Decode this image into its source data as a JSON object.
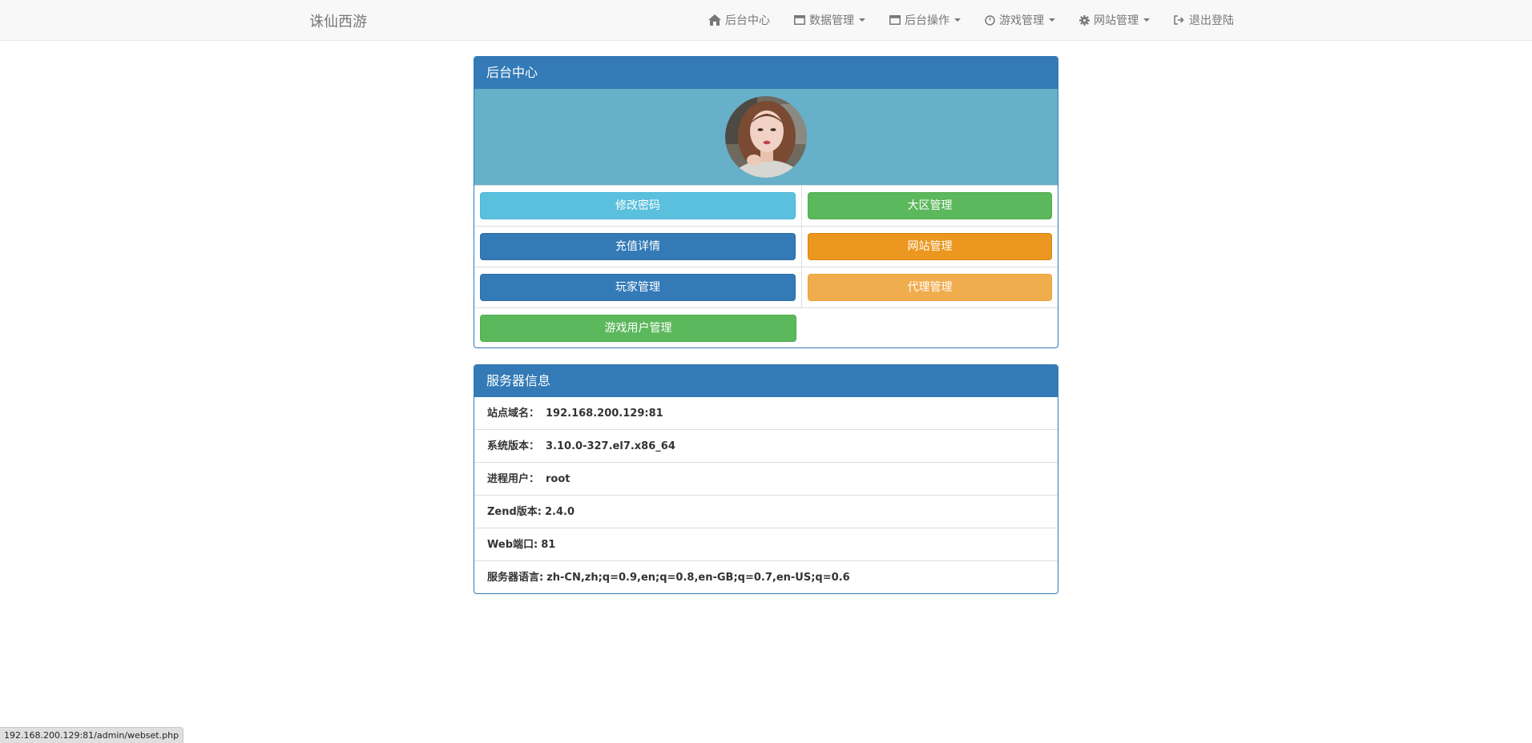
{
  "brand": "诛仙西游",
  "nav": {
    "items": [
      {
        "label": "后台中心",
        "icon": "home-icon",
        "dropdown": false
      },
      {
        "label": "数据管理",
        "icon": "window-icon",
        "dropdown": true
      },
      {
        "label": "后台操作",
        "icon": "window-icon",
        "dropdown": true
      },
      {
        "label": "游戏管理",
        "icon": "dashboard-icon",
        "dropdown": true
      },
      {
        "label": "网站管理",
        "icon": "gear-icon",
        "dropdown": true
      },
      {
        "label": "退出登陆",
        "icon": "logout-icon",
        "dropdown": false
      }
    ]
  },
  "admin_panel": {
    "title": "后台中心",
    "avatar": "user-avatar-photo",
    "buttons": {
      "change_password": "修改密码",
      "region_manage": "大区管理",
      "recharge_details": "充值详情",
      "site_manage": "网站管理",
      "player_manage": "玩家管理",
      "agent_manage": "代理管理",
      "game_user_manage": "游戏用户管理"
    }
  },
  "server_panel": {
    "title": "服务器信息",
    "rows": [
      {
        "label": "站点域名：",
        "value": "192.168.200.129:81"
      },
      {
        "label": "系统版本：",
        "value": "3.10.0-327.el7.x86_64"
      },
      {
        "label": "进程用户：",
        "value": "root"
      },
      {
        "label": "Zend版本:",
        "value": "2.4.0"
      },
      {
        "label": "Web端口:",
        "value": "81"
      },
      {
        "label": "服务器语言:",
        "value": "zh-CN,zh;q=0.9,en;q=0.8,en-GB;q=0.7,en-US;q=0.6"
      }
    ]
  },
  "status_url": "192.168.200.129:81/admin/webset.php",
  "colors": {
    "primary": "#337ab7",
    "info": "#5bc0de",
    "success": "#5cb85c",
    "warning": "#ec971f",
    "warning_light": "#f0ad4e",
    "avatar_bg": "#66b0c9"
  }
}
